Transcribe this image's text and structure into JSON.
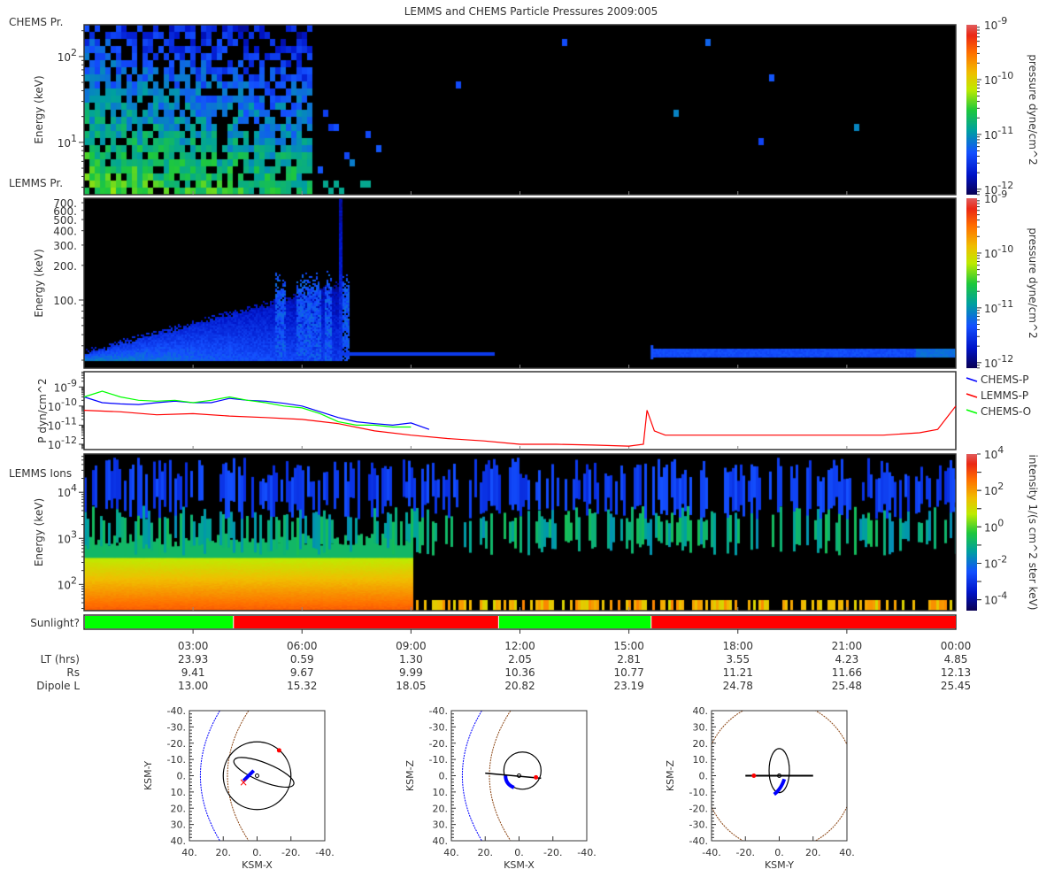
{
  "title": "LEMMS and CHEMS Particle Pressures  2009:005",
  "panels": {
    "chems": {
      "label": "CHEMS Pr.",
      "ylabel": "Energy (keV)",
      "yticks": [
        "10^2",
        "10^1"
      ],
      "cbar_label": "pressure dyne/cm^2",
      "cbar_ticks": [
        "10^-9",
        "10^-10",
        "10^-11",
        "10^-12"
      ]
    },
    "lemms_pr": {
      "label": "LEMMS Pr.",
      "ylabel": "Energy (keV)",
      "yticks": [
        "700.",
        "600.",
        "500.",
        "400.",
        "300.",
        "200.",
        "100."
      ],
      "cbar_label": "pressure dyne/cm^2",
      "cbar_ticks": [
        "10^-9",
        "10^-10",
        "10^-11",
        "10^-12"
      ]
    },
    "pressure": {
      "ylabel": "P dyn/cm^2",
      "yticks": [
        "10^-9",
        "10^-10",
        "10^-11",
        "10^-12"
      ],
      "legend": [
        "CHEMS-P",
        "LEMMS-P",
        "CHEMS-O"
      ]
    },
    "lemms_ions": {
      "label": "LEMMS Ions",
      "ylabel": "Energy (keV)",
      "yticks": [
        "10^4",
        "10^3",
        "10^2"
      ],
      "cbar_label": "intensity 1/(s cm^2 ster keV)",
      "cbar_ticks": [
        "10^4",
        "10^2",
        "10^0",
        "10^-2",
        "10^-4"
      ]
    },
    "sunlight": {
      "label": "Sunlight?",
      "segments": [
        {
          "from": 0,
          "to": 4.1,
          "state": "yes"
        },
        {
          "from": 4.1,
          "to": 11.4,
          "state": "no"
        },
        {
          "from": 11.4,
          "to": 15.6,
          "state": "yes"
        },
        {
          "from": 15.6,
          "to": 24,
          "state": "no"
        }
      ],
      "colors": {
        "yes": "#00ff00",
        "no": "#ff0000"
      }
    }
  },
  "chart_data": [
    {
      "type": "heatmap",
      "name": "CHEMS Pr.",
      "ylabel": "Energy (keV)",
      "yscale": "log",
      "ylim": [
        2.5,
        235
      ],
      "xlim": [
        "00:00",
        "24:00"
      ],
      "colorscale": "log",
      "clim": [
        1e-12,
        1e-09
      ]
    },
    {
      "type": "heatmap",
      "name": "LEMMS Pr.",
      "ylabel": "Energy (keV)",
      "yscale": "log",
      "ylim": [
        26,
        765
      ],
      "xlim": [
        "00:00",
        "24:00"
      ],
      "colorscale": "log",
      "clim": [
        1e-12,
        1e-09
      ]
    },
    {
      "type": "line",
      "ylabel": "P dyn/cm^2",
      "yscale": "log",
      "ylim": [
        5e-13,
        6e-09
      ],
      "xunit": "hours",
      "series": [
        {
          "name": "CHEMS-P",
          "color": "#0000ff",
          "x": [
            0,
            0.5,
            1,
            1.5,
            2,
            2.5,
            3,
            3.5,
            4,
            4.5,
            5,
            5.5,
            6,
            6.5,
            7,
            7.5,
            8,
            8.5,
            9,
            9.5
          ],
          "y": [
            3e-10,
            1.5e-10,
            1.3e-10,
            1.2e-10,
            1.5e-10,
            1.8e-10,
            1.5e-10,
            1.5e-10,
            2.5e-10,
            2e-10,
            1.8e-10,
            1.4e-10,
            1e-10,
            5e-11,
            2.5e-11,
            1.5e-11,
            1.2e-11,
            1e-11,
            1.3e-11,
            6e-12
          ]
        },
        {
          "name": "LEMMS-P",
          "color": "#ff0000",
          "x": [
            0,
            1,
            2,
            3,
            4,
            5,
            6,
            7,
            8,
            9,
            10,
            11,
            12,
            13,
            14,
            15,
            15.4,
            15.5,
            15.7,
            16,
            17,
            18,
            19,
            20,
            21,
            22,
            23,
            23.5,
            24
          ],
          "y": [
            6e-11,
            5e-11,
            3.5e-11,
            4e-11,
            3e-11,
            2.5e-11,
            2e-11,
            1.2e-11,
            5e-12,
            3e-12,
            2e-12,
            1.5e-12,
            1e-12,
            1e-12,
            9e-13,
            8e-13,
            1e-12,
            6e-11,
            5e-12,
            3e-12,
            3e-12,
            3e-12,
            3e-12,
            3e-12,
            3e-12,
            3e-12,
            4e-12,
            6e-12,
            1e-10
          ]
        },
        {
          "name": "CHEMS-O",
          "color": "#00ff00",
          "x": [
            0,
            0.5,
            1,
            1.5,
            2,
            2.5,
            3,
            3.5,
            4,
            4.5,
            5,
            5.5,
            6,
            6.5,
            7,
            7.5,
            8,
            8.5,
            9
          ],
          "y": [
            3e-10,
            6e-10,
            3e-10,
            2e-10,
            1.8e-10,
            2e-10,
            1.5e-10,
            2e-10,
            3e-10,
            2e-10,
            1.5e-10,
            1e-10,
            8e-11,
            4e-11,
            1.5e-11,
            1e-11,
            1e-11,
            8e-12,
            8e-12
          ]
        }
      ]
    },
    {
      "type": "heatmap",
      "name": "LEMMS Ions",
      "ylabel": "Energy (keV)",
      "yscale": "log",
      "ylim": [
        27,
        68000
      ],
      "xlim": [
        "00:00",
        "24:00"
      ],
      "colorscale": "log",
      "clim": [
        1e-05,
        10000.0
      ]
    }
  ],
  "time_axis": {
    "ticks": [
      "03:00",
      "06:00",
      "09:00",
      "12:00",
      "15:00",
      "18:00",
      "21:00",
      "00:00"
    ]
  },
  "ephemeris": {
    "rows": [
      {
        "label": "LT (hrs)",
        "values": [
          "23.93",
          "0.59",
          "1.30",
          "2.05",
          "2.81",
          "3.55",
          "4.23",
          "4.85"
        ]
      },
      {
        "label": "Rs",
        "values": [
          "9.41",
          "9.67",
          "9.99",
          "10.36",
          "10.77",
          "11.21",
          "11.66",
          "12.13"
        ]
      },
      {
        "label": "Dipole L",
        "values": [
          "13.00",
          "15.32",
          "18.05",
          "20.82",
          "23.19",
          "24.78",
          "25.48",
          "25.45"
        ]
      }
    ]
  },
  "orbits": [
    {
      "xlabel": "KSM-X",
      "ylabel": "KSM-Y",
      "xticks": [
        "40.",
        "20.",
        "0.",
        "-20.",
        "-40."
      ],
      "yticks": [
        "-40.",
        "-30.",
        "-20.",
        "-10.",
        "0.",
        "10.",
        "20.",
        "30.",
        "40."
      ]
    },
    {
      "xlabel": "KSM-X",
      "ylabel": "KSM-Z",
      "xticks": [
        "40.",
        "20.",
        "0.",
        "-20.",
        "-40."
      ],
      "yticks": [
        "-40.",
        "-30.",
        "-20.",
        "-10.",
        "0.",
        "10.",
        "20.",
        "30.",
        "40."
      ]
    },
    {
      "xlabel": "KSM-Y",
      "ylabel": "KSM-Z",
      "xticks": [
        "-40.",
        "-20.",
        "0.",
        "20.",
        "40."
      ],
      "yticks": [
        "40.",
        "30.",
        "20.",
        "10.",
        "0.",
        "-10.",
        "-20.",
        "-30.",
        "-40."
      ]
    }
  ],
  "colors": {
    "magnetopause": "#0000ff",
    "bow_shock": "#8b4513",
    "orbit": "#000000",
    "track": "#0000ff",
    "marker": "#ff0000"
  }
}
